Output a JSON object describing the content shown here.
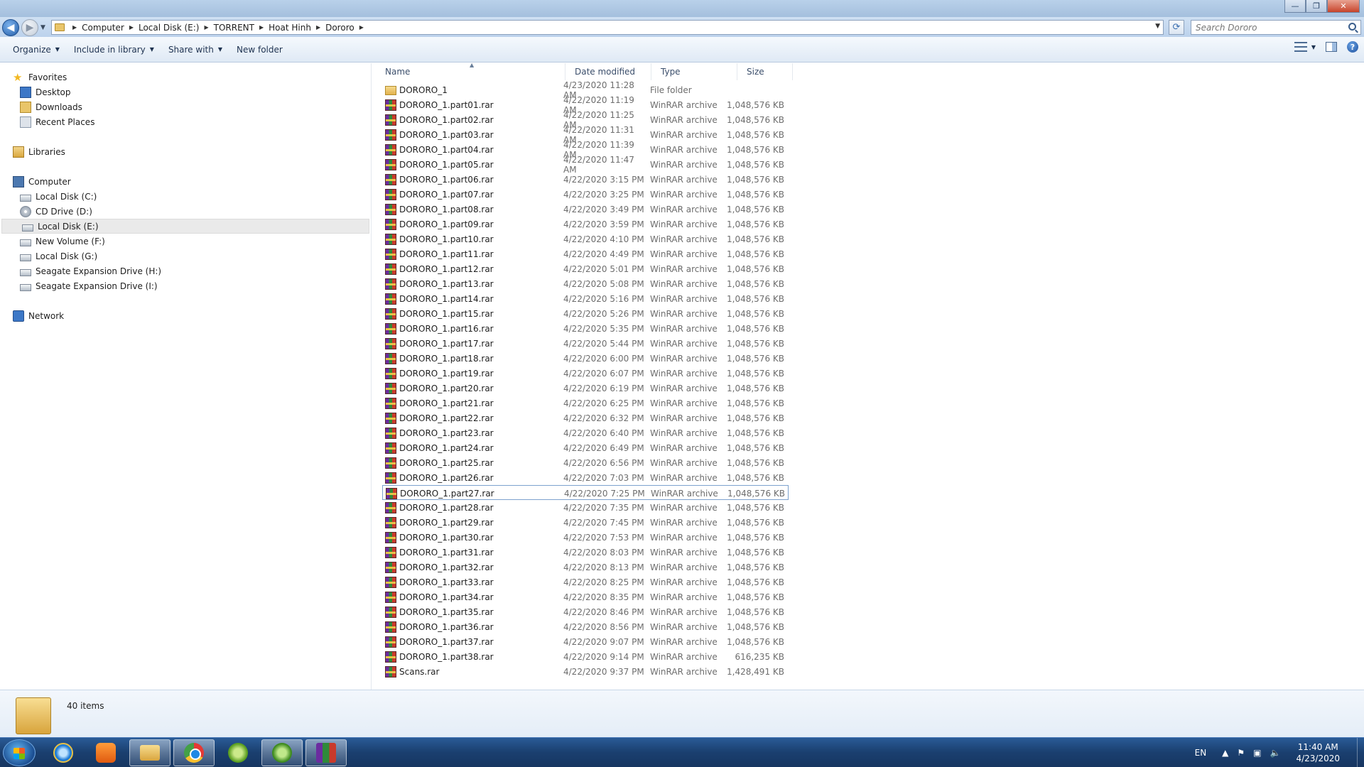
{
  "window": {
    "minimize_glyph": "—",
    "maximize_glyph": "❐",
    "close_glyph": "✕"
  },
  "address": {
    "crumbs": [
      "Computer",
      "Local Disk (E:)",
      "TORRENT",
      "Hoat Hinh",
      "Dororo"
    ],
    "search_placeholder": "Search Dororo"
  },
  "toolbar": {
    "organize": "Organize",
    "include_in_library": "Include in library",
    "share_with": "Share with",
    "new_folder": "New folder"
  },
  "nav": {
    "favorites": "Favorites",
    "desktop": "Desktop",
    "downloads": "Downloads",
    "recent_places": "Recent Places",
    "libraries": "Libraries",
    "computer": "Computer",
    "drives": [
      "Local Disk (C:)",
      "CD Drive (D:)",
      "Local Disk (E:)",
      "New Volume (F:)",
      "Local Disk (G:)",
      "Seagate Expansion Drive (H:)",
      "Seagate Expansion Drive (I:)"
    ],
    "network": "Network"
  },
  "columns": {
    "name": "Name",
    "date": "Date modified",
    "type": "Type",
    "size": "Size"
  },
  "files": [
    {
      "name": "DORORO_1",
      "date": "4/23/2020 11:28 AM",
      "type": "File folder",
      "size": "",
      "icon": "folder-icon"
    },
    {
      "name": "DORORO_1.part01.rar",
      "date": "4/22/2020 11:19 AM",
      "type": "WinRAR archive",
      "size": "1,048,576 KB",
      "icon": "rar-icon"
    },
    {
      "name": "DORORO_1.part02.rar",
      "date": "4/22/2020 11:25 AM",
      "type": "WinRAR archive",
      "size": "1,048,576 KB",
      "icon": "rar-icon"
    },
    {
      "name": "DORORO_1.part03.rar",
      "date": "4/22/2020 11:31 AM",
      "type": "WinRAR archive",
      "size": "1,048,576 KB",
      "icon": "rar-icon"
    },
    {
      "name": "DORORO_1.part04.rar",
      "date": "4/22/2020 11:39 AM",
      "type": "WinRAR archive",
      "size": "1,048,576 KB",
      "icon": "rar-icon"
    },
    {
      "name": "DORORO_1.part05.rar",
      "date": "4/22/2020 11:47 AM",
      "type": "WinRAR archive",
      "size": "1,048,576 KB",
      "icon": "rar-icon"
    },
    {
      "name": "DORORO_1.part06.rar",
      "date": "4/22/2020 3:15 PM",
      "type": "WinRAR archive",
      "size": "1,048,576 KB",
      "icon": "rar-icon"
    },
    {
      "name": "DORORO_1.part07.rar",
      "date": "4/22/2020 3:25 PM",
      "type": "WinRAR archive",
      "size": "1,048,576 KB",
      "icon": "rar-icon"
    },
    {
      "name": "DORORO_1.part08.rar",
      "date": "4/22/2020 3:49 PM",
      "type": "WinRAR archive",
      "size": "1,048,576 KB",
      "icon": "rar-icon"
    },
    {
      "name": "DORORO_1.part09.rar",
      "date": "4/22/2020 3:59 PM",
      "type": "WinRAR archive",
      "size": "1,048,576 KB",
      "icon": "rar-icon"
    },
    {
      "name": "DORORO_1.part10.rar",
      "date": "4/22/2020 4:10 PM",
      "type": "WinRAR archive",
      "size": "1,048,576 KB",
      "icon": "rar-icon"
    },
    {
      "name": "DORORO_1.part11.rar",
      "date": "4/22/2020 4:49 PM",
      "type": "WinRAR archive",
      "size": "1,048,576 KB",
      "icon": "rar-icon"
    },
    {
      "name": "DORORO_1.part12.rar",
      "date": "4/22/2020 5:01 PM",
      "type": "WinRAR archive",
      "size": "1,048,576 KB",
      "icon": "rar-icon"
    },
    {
      "name": "DORORO_1.part13.rar",
      "date": "4/22/2020 5:08 PM",
      "type": "WinRAR archive",
      "size": "1,048,576 KB",
      "icon": "rar-icon"
    },
    {
      "name": "DORORO_1.part14.rar",
      "date": "4/22/2020 5:16 PM",
      "type": "WinRAR archive",
      "size": "1,048,576 KB",
      "icon": "rar-icon"
    },
    {
      "name": "DORORO_1.part15.rar",
      "date": "4/22/2020 5:26 PM",
      "type": "WinRAR archive",
      "size": "1,048,576 KB",
      "icon": "rar-icon"
    },
    {
      "name": "DORORO_1.part16.rar",
      "date": "4/22/2020 5:35 PM",
      "type": "WinRAR archive",
      "size": "1,048,576 KB",
      "icon": "rar-icon"
    },
    {
      "name": "DORORO_1.part17.rar",
      "date": "4/22/2020 5:44 PM",
      "type": "WinRAR archive",
      "size": "1,048,576 KB",
      "icon": "rar-icon"
    },
    {
      "name": "DORORO_1.part18.rar",
      "date": "4/22/2020 6:00 PM",
      "type": "WinRAR archive",
      "size": "1,048,576 KB",
      "icon": "rar-icon"
    },
    {
      "name": "DORORO_1.part19.rar",
      "date": "4/22/2020 6:07 PM",
      "type": "WinRAR archive",
      "size": "1,048,576 KB",
      "icon": "rar-icon"
    },
    {
      "name": "DORORO_1.part20.rar",
      "date": "4/22/2020 6:19 PM",
      "type": "WinRAR archive",
      "size": "1,048,576 KB",
      "icon": "rar-icon"
    },
    {
      "name": "DORORO_1.part21.rar",
      "date": "4/22/2020 6:25 PM",
      "type": "WinRAR archive",
      "size": "1,048,576 KB",
      "icon": "rar-icon"
    },
    {
      "name": "DORORO_1.part22.rar",
      "date": "4/22/2020 6:32 PM",
      "type": "WinRAR archive",
      "size": "1,048,576 KB",
      "icon": "rar-icon"
    },
    {
      "name": "DORORO_1.part23.rar",
      "date": "4/22/2020 6:40 PM",
      "type": "WinRAR archive",
      "size": "1,048,576 KB",
      "icon": "rar-icon"
    },
    {
      "name": "DORORO_1.part24.rar",
      "date": "4/22/2020 6:49 PM",
      "type": "WinRAR archive",
      "size": "1,048,576 KB",
      "icon": "rar-icon"
    },
    {
      "name": "DORORO_1.part25.rar",
      "date": "4/22/2020 6:56 PM",
      "type": "WinRAR archive",
      "size": "1,048,576 KB",
      "icon": "rar-icon"
    },
    {
      "name": "DORORO_1.part26.rar",
      "date": "4/22/2020 7:03 PM",
      "type": "WinRAR archive",
      "size": "1,048,576 KB",
      "icon": "rar-icon"
    },
    {
      "name": "DORORO_1.part27.rar",
      "date": "4/22/2020 7:25 PM",
      "type": "WinRAR archive",
      "size": "1,048,576 KB",
      "icon": "rar-icon",
      "focused": true
    },
    {
      "name": "DORORO_1.part28.rar",
      "date": "4/22/2020 7:35 PM",
      "type": "WinRAR archive",
      "size": "1,048,576 KB",
      "icon": "rar-icon"
    },
    {
      "name": "DORORO_1.part29.rar",
      "date": "4/22/2020 7:45 PM",
      "type": "WinRAR archive",
      "size": "1,048,576 KB",
      "icon": "rar-icon"
    },
    {
      "name": "DORORO_1.part30.rar",
      "date": "4/22/2020 7:53 PM",
      "type": "WinRAR archive",
      "size": "1,048,576 KB",
      "icon": "rar-icon"
    },
    {
      "name": "DORORO_1.part31.rar",
      "date": "4/22/2020 8:03 PM",
      "type": "WinRAR archive",
      "size": "1,048,576 KB",
      "icon": "rar-icon"
    },
    {
      "name": "DORORO_1.part32.rar",
      "date": "4/22/2020 8:13 PM",
      "type": "WinRAR archive",
      "size": "1,048,576 KB",
      "icon": "rar-icon"
    },
    {
      "name": "DORORO_1.part33.rar",
      "date": "4/22/2020 8:25 PM",
      "type": "WinRAR archive",
      "size": "1,048,576 KB",
      "icon": "rar-icon"
    },
    {
      "name": "DORORO_1.part34.rar",
      "date": "4/22/2020 8:35 PM",
      "type": "WinRAR archive",
      "size": "1,048,576 KB",
      "icon": "rar-icon"
    },
    {
      "name": "DORORO_1.part35.rar",
      "date": "4/22/2020 8:46 PM",
      "type": "WinRAR archive",
      "size": "1,048,576 KB",
      "icon": "rar-icon"
    },
    {
      "name": "DORORO_1.part36.rar",
      "date": "4/22/2020 8:56 PM",
      "type": "WinRAR archive",
      "size": "1,048,576 KB",
      "icon": "rar-icon"
    },
    {
      "name": "DORORO_1.part37.rar",
      "date": "4/22/2020 9:07 PM",
      "type": "WinRAR archive",
      "size": "1,048,576 KB",
      "icon": "rar-icon"
    },
    {
      "name": "DORORO_1.part38.rar",
      "date": "4/22/2020 9:14 PM",
      "type": "WinRAR archive",
      "size": "616,235 KB",
      "icon": "rar-icon"
    },
    {
      "name": "Scans.rar",
      "date": "4/22/2020 9:37 PM",
      "type": "WinRAR archive",
      "size": "1,428,491 KB",
      "icon": "rar-icon"
    }
  ],
  "status": {
    "item_count": "40 items"
  },
  "taskbar": {
    "language": "EN",
    "time": "11:40 AM",
    "date": "4/23/2020",
    "apps": [
      "internet-explorer-icon",
      "media-player-icon",
      "windows-explorer-icon",
      "chrome-icon",
      "ccleaner-icon",
      "utorrent-icon",
      "winrar-icon"
    ]
  }
}
